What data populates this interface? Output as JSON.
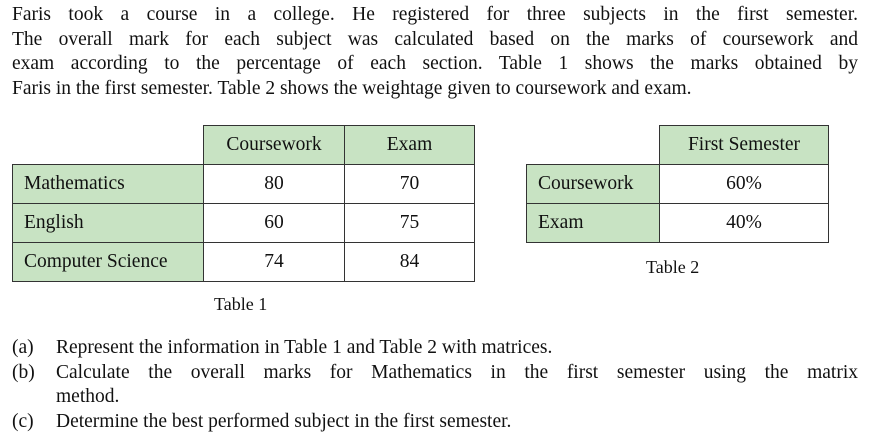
{
  "intro_lines": [
    "Faris took a course in a college. He registered for three subjects in the first semester.",
    "The overall mark for each subject was calculated based on the marks of coursework and",
    "exam according to the percentage of each section. Table 1 shows the marks obtained by",
    "Faris in the first semester. Table 2 shows the weightage given to coursework and exam."
  ],
  "table1": {
    "headers": [
      "Coursework",
      "Exam"
    ],
    "rows": [
      {
        "subject": "Mathematics",
        "coursework": "80",
        "exam": "70"
      },
      {
        "subject": "English",
        "coursework": "60",
        "exam": "75"
      },
      {
        "subject": "Computer Science",
        "coursework": "74",
        "exam": "84"
      }
    ],
    "caption": "Table 1"
  },
  "table2": {
    "header": "First Semester",
    "rows": [
      {
        "label": "Coursework",
        "value": "60%"
      },
      {
        "label": "Exam",
        "value": "40%"
      }
    ],
    "caption": "Table 2"
  },
  "questions": [
    {
      "label": "(a)",
      "lines": [
        "Represent the information in Table 1 and Table 2 with matrices."
      ]
    },
    {
      "label": "(b)",
      "lines": [
        "Calculate the overall marks for Mathematics in the first semester using the matrix",
        "method."
      ]
    },
    {
      "label": "(c)",
      "lines": [
        "Determine the best performed subject in the first semester."
      ]
    }
  ]
}
